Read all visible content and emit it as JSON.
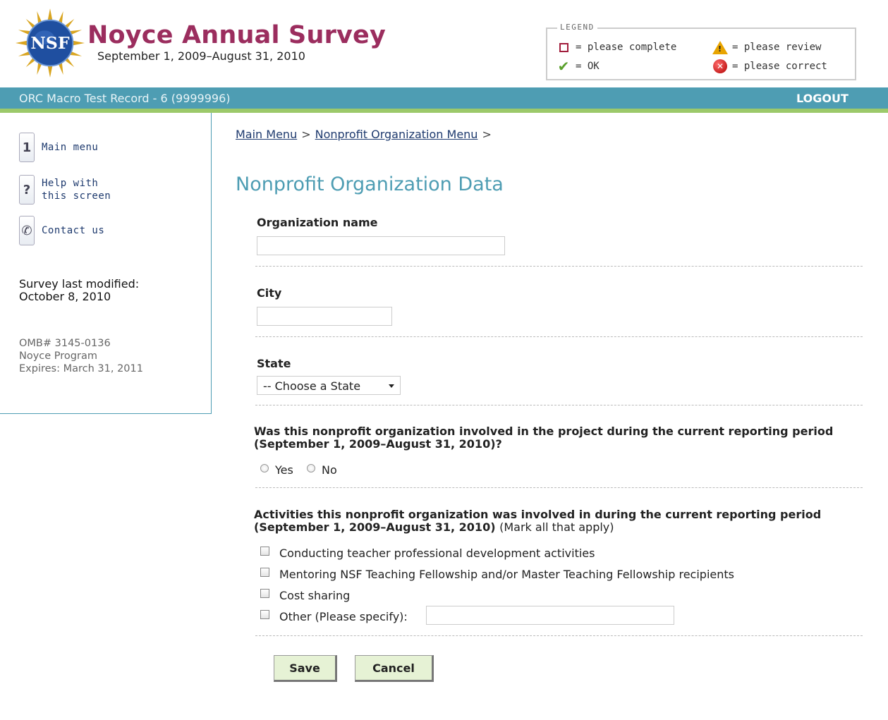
{
  "header": {
    "logo_text": "NSF",
    "title": "Noyce Annual Survey",
    "dates": "September 1, 2009–August 31, 2010"
  },
  "legend": {
    "title": "LEGEND",
    "items": [
      {
        "icon": "empty-square-icon",
        "label": "= please complete"
      },
      {
        "icon": "warning-triangle-icon",
        "label": "= please review"
      },
      {
        "icon": "checkmark-icon",
        "label": "= OK"
      },
      {
        "icon": "error-x-icon",
        "label": "= please correct"
      }
    ]
  },
  "topbar": {
    "record": "ORC Macro Test Record - 6 (9999996)",
    "logout": "LOGOUT"
  },
  "sidebar": {
    "links": [
      {
        "icon": "main-menu-icon",
        "label_line1": "Main menu",
        "label_line2": ""
      },
      {
        "icon": "help-icon",
        "label_line1": "Help with",
        "label_line2": "this screen"
      },
      {
        "icon": "phone-icon",
        "label_line1": "Contact us",
        "label_line2": ""
      }
    ],
    "modified_label": "Survey last modified:",
    "modified_date": "October 8, 2010",
    "omb": "OMB# 3145-0136",
    "program": "Noyce Program",
    "expires": "Expires: March 31, 2011"
  },
  "breadcrumb": {
    "items": [
      "Main Menu",
      "Nonprofit Organization Menu"
    ],
    "separator": ">"
  },
  "page_title": "Nonprofit Organization Data",
  "form": {
    "org_name": {
      "label": "Organization name",
      "value": ""
    },
    "city": {
      "label": "City",
      "value": ""
    },
    "state": {
      "label": "State",
      "selected": "-- Choose a State"
    },
    "involved": {
      "question_line1": "Was this nonprofit organization involved in the project during the current reporting period",
      "question_line2": "(September 1, 2009–August 31, 2010)?",
      "options": [
        "Yes",
        "No"
      ],
      "selected": null
    },
    "activities": {
      "question_line1": "Activities this nonprofit organization was involved in during the current reporting period",
      "question_line2": "(September 1, 2009–August 31, 2010)",
      "hint": "(Mark all that apply)",
      "options": [
        "Conducting teacher professional development activities",
        "Mentoring NSF Teaching Fellowship and/or Master Teaching Fellowship recipients",
        "Cost sharing",
        "Other (Please specify):"
      ],
      "other_value": ""
    }
  },
  "buttons": {
    "save": "Save",
    "cancel": "Cancel"
  },
  "colors": {
    "title": "#9b2d5e",
    "bar": "#4e9db3",
    "bar_accent": "#9cc96a",
    "button_bg": "#e6f2d5"
  }
}
